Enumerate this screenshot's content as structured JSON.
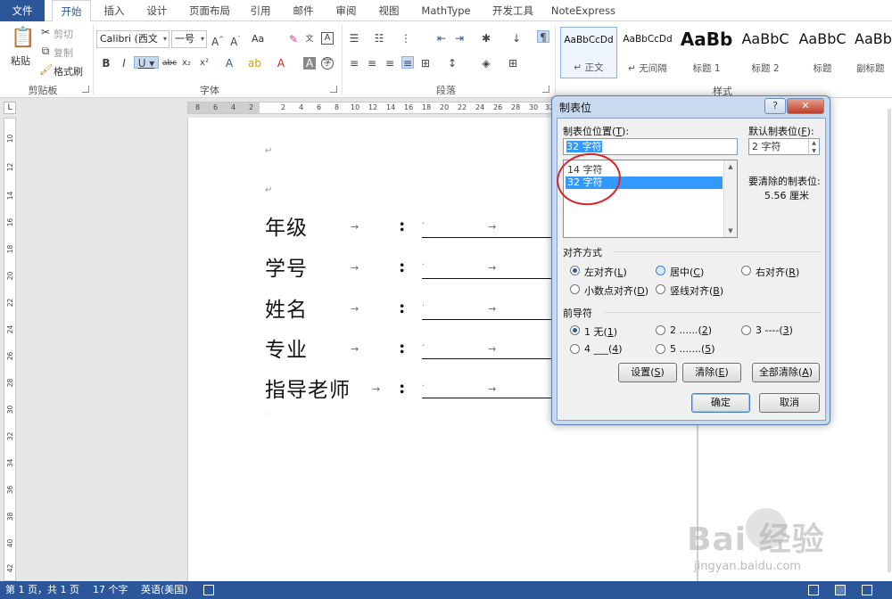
{
  "tabs": [
    {
      "label": "文件"
    },
    {
      "label": "开始"
    },
    {
      "label": "插入"
    },
    {
      "label": "设计"
    },
    {
      "label": "页面布局"
    },
    {
      "label": "引用"
    },
    {
      "label": "邮件"
    },
    {
      "label": "审阅"
    },
    {
      "label": "视图"
    },
    {
      "label": "MathType"
    },
    {
      "label": "开发工具"
    },
    {
      "label": "NoteExpress"
    }
  ],
  "ribbon": {
    "clipboard": {
      "paste": "粘贴",
      "cut": "剪切",
      "copy": "复制",
      "format_painter": "格式刷",
      "group": "剪贴板"
    },
    "font": {
      "name": "Calibri (西文",
      "size": "一号",
      "group": "字体",
      "case": "Aa"
    },
    "paragraph": {
      "group": "段落"
    },
    "styles": {
      "group": "样式",
      "items": [
        {
          "sample": "AaBbCcDd",
          "name": "↵ 正文"
        },
        {
          "sample": "AaBbCcDd",
          "name": "↵ 无间隔"
        },
        {
          "sample": "AaBb",
          "name": "标题 1"
        },
        {
          "sample": "AaBbC",
          "name": "标题 2"
        },
        {
          "sample": "AaBbC",
          "name": "标题"
        },
        {
          "sample": "AaBb",
          "name": "副标题"
        }
      ]
    }
  },
  "ruler": {
    "h_ticks": [
      "8",
      "6",
      "4",
      "2",
      "2",
      "4",
      "6",
      "8",
      "10",
      "12",
      "14",
      "16",
      "18",
      "20",
      "22",
      "24",
      "26",
      "28",
      "30",
      "32"
    ],
    "v_ticks": [
      "10",
      "12",
      "14",
      "16",
      "18",
      "20",
      "22",
      "24",
      "26",
      "28",
      "30",
      "32",
      "34",
      "36",
      "38",
      "40",
      "42"
    ]
  },
  "document": {
    "para_mark": "↵",
    "tab_mark": "→",
    "colon": ":",
    "dot": "·",
    "rows": [
      {
        "label": "年级"
      },
      {
        "label": "学号"
      },
      {
        "label": "姓名"
      },
      {
        "label": "专业"
      },
      {
        "label": "指导老师"
      }
    ]
  },
  "dialog": {
    "title": "制表位",
    "help": "?",
    "close": "✕",
    "tab_pos_label": "制表位位置(",
    "tab_pos_key": "T",
    "tab_pos_value": "32 字符",
    "tab_list": [
      "14 字符",
      "32 字符"
    ],
    "default_label": "默认制表位(",
    "default_key": "F",
    "default_value": "2 字符",
    "clear_label": "要清除的制表位:",
    "clear_value": "5.56 厘米",
    "align_title": "对齐方式",
    "align": [
      {
        "label": "左对齐(",
        "key": "L"
      },
      {
        "label": "居中(",
        "key": "C"
      },
      {
        "label": "右对齐(",
        "key": "R"
      },
      {
        "label": "小数点对齐(",
        "key": "D"
      },
      {
        "label": "竖线对齐(",
        "key": "B"
      }
    ],
    "leader_title": "前导符",
    "leader": [
      {
        "label": "1 无(",
        "key": "1"
      },
      {
        "label": "2 ......(",
        "key": "2"
      },
      {
        "label": "3 ----(",
        "key": "3"
      },
      {
        "label": "4 ___(",
        "key": "4"
      },
      {
        "label": "5 .......(",
        "key": "5"
      }
    ],
    "btn_set": "设置(",
    "btn_set_key": "S",
    "btn_clear": "清除(",
    "btn_clear_key": "E",
    "btn_clear_all": "全部清除(",
    "btn_clear_all_key": "A",
    "ok": "确定",
    "cancel": "取消"
  },
  "status": {
    "page": "第 1 页，共 1 页",
    "words": "17 个字",
    "lang": "英语(美国)"
  },
  "watermark": {
    "main": "Bai  经验",
    "sub": "jingyan.baidu.com"
  },
  "colors": {
    "accent": "#2b579a",
    "selection": "#3399ff",
    "annotation": "#d8252a"
  }
}
